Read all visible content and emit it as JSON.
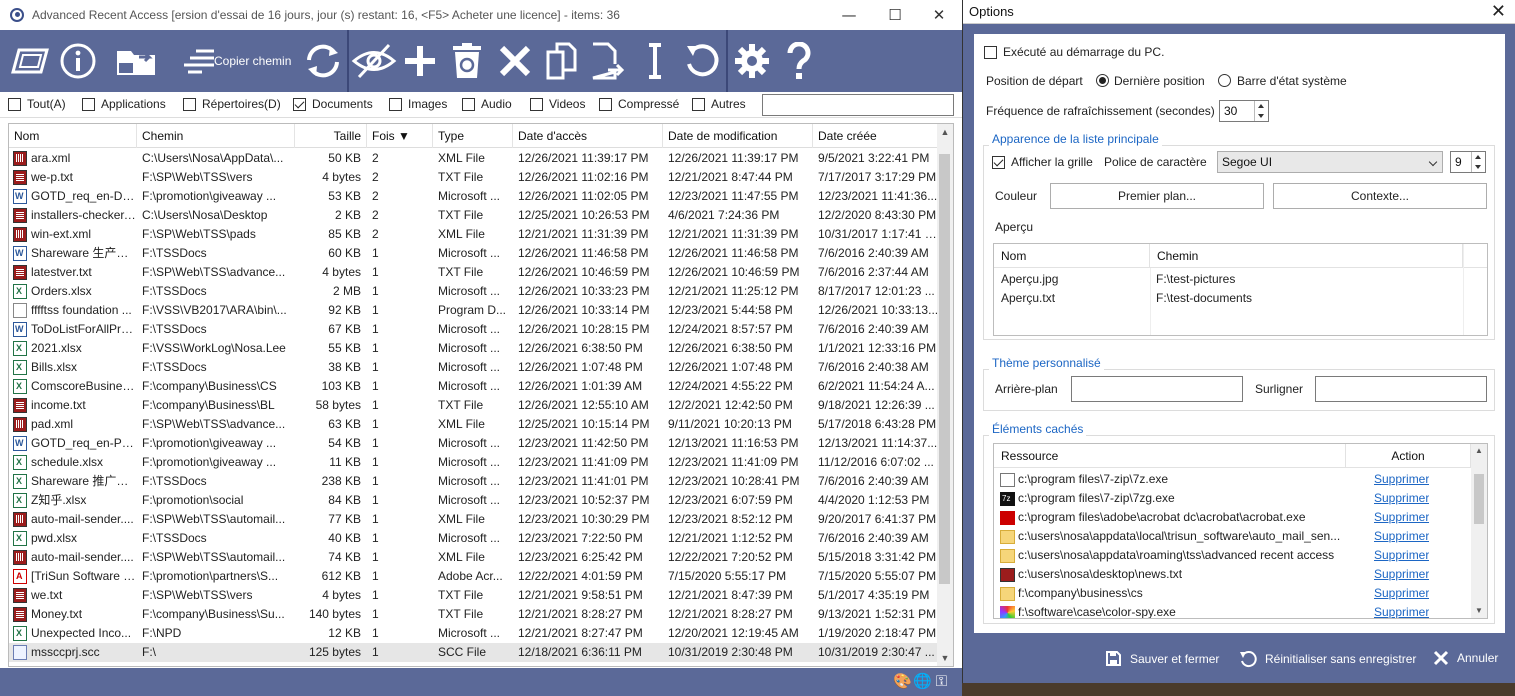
{
  "main_window": {
    "title": "Advanced Recent Access [ersion d'essai de 16 jours, jour (s) restant: 16, <F5> Acheter une licence] - items: 36",
    "minimize": "—",
    "maximize": "☐",
    "close": "✕"
  },
  "toolbar": {
    "copy_path_label": "Copier chemin"
  },
  "filters": [
    {
      "label": "Tout(A)",
      "checked": false
    },
    {
      "label": "Applications",
      "checked": false
    },
    {
      "label": "Répertoires(D)",
      "checked": false
    },
    {
      "label": "Documents",
      "checked": true
    },
    {
      "label": "Images",
      "checked": false
    },
    {
      "label": "Audio",
      "checked": false
    },
    {
      "label": "Videos",
      "checked": false
    },
    {
      "label": "Compressé",
      "checked": false
    },
    {
      "label": "Autres",
      "checked": false
    }
  ],
  "filter_search_value": "",
  "columns": [
    "Nom",
    "Chemin",
    "Taille",
    "Fois ▼",
    "Type",
    "Date d'accès",
    "Date de modification",
    "Date créée"
  ],
  "rows": [
    {
      "icon": "xml",
      "name": "ara.xml",
      "path": "C:\\Users\\Nosa\\AppData\\...",
      "size": "50 KB",
      "times": "2",
      "type": "XML File",
      "accessed": "12/26/2021 11:39:17 PM",
      "modified": "12/26/2021 11:39:17 PM",
      "created": "9/5/2021 3:22:41 PM"
    },
    {
      "icon": "text",
      "name": "we-p.txt",
      "path": "F:\\SP\\Web\\TSS\\vers",
      "size": "4 bytes",
      "times": "2",
      "type": "TXT File",
      "accessed": "12/26/2021 11:02:16 PM",
      "modified": "12/21/2021 8:47:44 PM",
      "created": "7/17/2017 3:17:29 PM"
    },
    {
      "icon": "word",
      "name": "GOTD_req_en-D2F...",
      "path": "F:\\promotion\\giveaway ...",
      "size": "53 KB",
      "times": "2",
      "type": "Microsoft ...",
      "accessed": "12/26/2021 11:02:05 PM",
      "modified": "12/23/2021 11:47:55 PM",
      "created": "12/23/2021 11:41:36..."
    },
    {
      "icon": "text",
      "name": "installers-checker....",
      "path": "C:\\Users\\Nosa\\Desktop",
      "size": "2 KB",
      "times": "2",
      "type": "TXT File",
      "accessed": "12/25/2021 10:26:53 PM",
      "modified": "4/6/2021 7:24:36 PM",
      "created": "12/2/2020 8:43:30 PM"
    },
    {
      "icon": "xml",
      "name": "win-ext.xml",
      "path": "F:\\SP\\Web\\TSS\\pads",
      "size": "85 KB",
      "times": "2",
      "type": "XML File",
      "accessed": "12/21/2021 11:31:39 PM",
      "modified": "12/21/2021 11:31:39 PM",
      "created": "10/31/2017 1:17:41 PM"
    },
    {
      "icon": "word",
      "name": "Shareware 生产经...",
      "path": "F:\\TSSDocs",
      "size": "60 KB",
      "times": "1",
      "type": "Microsoft ...",
      "accessed": "12/26/2021 11:46:58 PM",
      "modified": "12/26/2021 11:46:58 PM",
      "created": "7/6/2016 2:40:39 AM"
    },
    {
      "icon": "text",
      "name": "latestver.txt",
      "path": "F:\\SP\\Web\\TSS\\advance...",
      "size": "4 bytes",
      "times": "1",
      "type": "TXT File",
      "accessed": "12/26/2021 10:46:59 PM",
      "modified": "12/26/2021 10:46:59 PM",
      "created": "7/6/2016 2:37:44 AM"
    },
    {
      "icon": "excel",
      "name": "Orders.xlsx",
      "path": "F:\\TSSDocs",
      "size": "2 MB",
      "times": "1",
      "type": "Microsoft ...",
      "accessed": "12/26/2021 10:33:23 PM",
      "modified": "12/21/2021 11:25:12 PM",
      "created": "8/17/2017 12:01:23 ..."
    },
    {
      "icon": "blank",
      "name": "fffftss foundation ...",
      "path": "F:\\VSS\\VB2017\\ARA\\bin\\...",
      "size": "92 KB",
      "times": "1",
      "type": "Program D...",
      "accessed": "12/26/2021 10:33:14 PM",
      "modified": "12/23/2021 5:44:58 PM",
      "created": "12/26/2021 10:33:13..."
    },
    {
      "icon": "word",
      "name": "ToDoListForAllPro...",
      "path": "F:\\TSSDocs",
      "size": "67 KB",
      "times": "1",
      "type": "Microsoft ...",
      "accessed": "12/26/2021 10:28:15 PM",
      "modified": "12/24/2021 8:57:57 PM",
      "created": "7/6/2016 2:40:39 AM"
    },
    {
      "icon": "excel",
      "name": "2021.xlsx",
      "path": "F:\\VSS\\WorkLog\\Nosa.Lee",
      "size": "55 KB",
      "times": "1",
      "type": "Microsoft ...",
      "accessed": "12/26/2021 6:38:50 PM",
      "modified": "12/26/2021 6:38:50 PM",
      "created": "1/1/2021 12:33:16 PM"
    },
    {
      "icon": "excel",
      "name": "Bills.xlsx",
      "path": "F:\\TSSDocs",
      "size": "38 KB",
      "times": "1",
      "type": "Microsoft ...",
      "accessed": "12/26/2021 1:07:48 PM",
      "modified": "12/26/2021 1:07:48 PM",
      "created": "7/6/2016 2:40:38 AM"
    },
    {
      "icon": "excel",
      "name": "ComscoreBusines...",
      "path": "F:\\company\\Business\\CS",
      "size": "103 KB",
      "times": "1",
      "type": "Microsoft ...",
      "accessed": "12/26/2021 1:01:39 AM",
      "modified": "12/24/2021 4:55:22 PM",
      "created": "6/2/2021 11:54:24 A..."
    },
    {
      "icon": "text",
      "name": "income.txt",
      "path": "F:\\company\\Business\\BL",
      "size": "58 bytes",
      "times": "1",
      "type": "TXT File",
      "accessed": "12/26/2021 12:55:10 AM",
      "modified": "12/2/2021 12:42:50 PM",
      "created": "9/18/2021 12:26:39 ..."
    },
    {
      "icon": "xml",
      "name": "pad.xml",
      "path": "F:\\SP\\Web\\TSS\\advance...",
      "size": "63 KB",
      "times": "1",
      "type": "XML File",
      "accessed": "12/25/2021 10:15:14 PM",
      "modified": "9/11/2021 10:20:13 PM",
      "created": "5/17/2018 6:43:28 PM"
    },
    {
      "icon": "word",
      "name": "GOTD_req_en-PTX...",
      "path": "F:\\promotion\\giveaway ...",
      "size": "54 KB",
      "times": "1",
      "type": "Microsoft ...",
      "accessed": "12/23/2021 11:42:50 PM",
      "modified": "12/13/2021 11:16:53 PM",
      "created": "12/13/2021 11:14:37..."
    },
    {
      "icon": "excel",
      "name": "schedule.xlsx",
      "path": "F:\\promotion\\giveaway ...",
      "size": "11 KB",
      "times": "1",
      "type": "Microsoft ...",
      "accessed": "12/23/2021 11:41:09 PM",
      "modified": "12/23/2021 11:41:09 PM",
      "created": "11/12/2016 6:07:02 ..."
    },
    {
      "icon": "excel",
      "name": "Shareware 推广经...",
      "path": "F:\\TSSDocs",
      "size": "238 KB",
      "times": "1",
      "type": "Microsoft ...",
      "accessed": "12/23/2021 11:41:01 PM",
      "modified": "12/23/2021 10:28:41 PM",
      "created": "7/6/2016 2:40:39 AM"
    },
    {
      "icon": "excel",
      "name": "Z知乎.xlsx",
      "path": "F:\\promotion\\social",
      "size": "84 KB",
      "times": "1",
      "type": "Microsoft ...",
      "accessed": "12/23/2021 10:52:37 PM",
      "modified": "12/23/2021 6:07:59 PM",
      "created": "4/4/2020 1:12:53 PM"
    },
    {
      "icon": "xml",
      "name": "auto-mail-sender....",
      "path": "F:\\SP\\Web\\TSS\\automail...",
      "size": "77 KB",
      "times": "1",
      "type": "XML File",
      "accessed": "12/23/2021 10:30:29 PM",
      "modified": "12/23/2021 8:52:12 PM",
      "created": "9/20/2017 6:41:37 PM"
    },
    {
      "icon": "excel",
      "name": "pwd.xlsx",
      "path": "F:\\TSSDocs",
      "size": "40 KB",
      "times": "1",
      "type": "Microsoft ...",
      "accessed": "12/23/2021 7:22:50 PM",
      "modified": "12/21/2021 1:12:52 PM",
      "created": "7/6/2016 2:40:39 AM"
    },
    {
      "icon": "xml",
      "name": "auto-mail-sender....",
      "path": "F:\\SP\\Web\\TSS\\automail...",
      "size": "74 KB",
      "times": "1",
      "type": "XML File",
      "accessed": "12/23/2021 6:25:42 PM",
      "modified": "12/22/2021 7:20:52 PM",
      "created": "5/15/2018 3:31:42 PM"
    },
    {
      "icon": "pdf",
      "name": "[TriSun Software x...",
      "path": "F:\\promotion\\partners\\S...",
      "size": "612 KB",
      "times": "1",
      "type": "Adobe Acr...",
      "accessed": "12/22/2021 4:01:59 PM",
      "modified": "7/15/2020 5:55:17 PM",
      "created": "7/15/2020 5:55:07 PM"
    },
    {
      "icon": "text",
      "name": "we.txt",
      "path": "F:\\SP\\Web\\TSS\\vers",
      "size": "4 bytes",
      "times": "1",
      "type": "TXT File",
      "accessed": "12/21/2021 9:58:51 PM",
      "modified": "12/21/2021 8:47:39 PM",
      "created": "5/1/2017 4:35:19 PM"
    },
    {
      "icon": "text",
      "name": "Money.txt",
      "path": "F:\\company\\Business\\Su...",
      "size": "140 bytes",
      "times": "1",
      "type": "TXT File",
      "accessed": "12/21/2021 8:28:27 PM",
      "modified": "12/21/2021 8:28:27 PM",
      "created": "9/13/2021 1:52:31 PM"
    },
    {
      "icon": "excel",
      "name": "Unexpected Inco...",
      "path": "F:\\NPD",
      "size": "12 KB",
      "times": "1",
      "type": "Microsoft ...",
      "accessed": "12/21/2021 8:27:47 PM",
      "modified": "12/20/2021 12:19:45 AM",
      "created": "1/19/2020 2:18:47 PM"
    },
    {
      "icon": "scc",
      "name": "mssccprj.scc",
      "path": "F:\\",
      "size": "125 bytes",
      "times": "1",
      "type": "SCC File",
      "accessed": "12/18/2021 6:36:11 PM",
      "modified": "10/31/2019 2:30:48 PM",
      "created": "10/31/2019 2:30:47 ...",
      "selected": true
    }
  ],
  "options": {
    "title": "Options",
    "close": "✕",
    "startup_label": "Exécuté au démarrage du PC.",
    "startup_checked": false,
    "start_position_label": "Position de départ",
    "start_pos_opt1": "Dernière position",
    "start_pos_opt2": "Barre d'état système",
    "start_pos_selected": "Dernière position",
    "refresh_label": "Fréquence de rafraîchissement (secondes)",
    "refresh_value": "30",
    "appearance_group": "Apparence de la liste principale",
    "show_grid_label": "Afficher la grille",
    "show_grid_checked": true,
    "font_label": "Police de caractère",
    "font_value": "Segoe UI",
    "font_size": "9",
    "color_label": "Couleur",
    "foreground_button": "Premier plan...",
    "background_button": "Contexte...",
    "preview_label": "Aperçu",
    "preview_columns": [
      "Nom",
      "Chemin"
    ],
    "preview_rows": [
      {
        "name": "Aperçu.jpg",
        "path": "F:\\test-pictures"
      },
      {
        "name": "Aperçu.txt",
        "path": "F:\\test-documents"
      }
    ],
    "theme_group": "Thème personnalisé",
    "theme_bg_label": "Arrière-plan",
    "theme_bg_value": "",
    "theme_hl_label": "Surligner",
    "theme_hl_value": "",
    "hidden_group": "Éléments cachés",
    "hidden_columns": [
      "Ressource",
      "Action"
    ],
    "hidden_items": [
      {
        "icon": "exe",
        "path": "c:\\program files\\7-zip\\7z.exe",
        "action": "Supprimer"
      },
      {
        "icon": "sevz",
        "path": "c:\\program files\\7-zip\\7zg.exe",
        "action": "Supprimer"
      },
      {
        "icon": "acro",
        "path": "c:\\program files\\adobe\\acrobat dc\\acrobat\\acrobat.exe",
        "action": "Supprimer"
      },
      {
        "icon": "folder",
        "path": "c:\\users\\nosa\\appdata\\local\\trisun_software\\auto_mail_sen...",
        "action": "Supprimer"
      },
      {
        "icon": "folder",
        "path": "c:\\users\\nosa\\appdata\\roaming\\tss\\advanced recent access",
        "action": "Supprimer"
      },
      {
        "icon": "news",
        "path": "c:\\users\\nosa\\desktop\\news.txt",
        "action": "Supprimer"
      },
      {
        "icon": "folder",
        "path": "f:\\company\\business\\cs",
        "action": "Supprimer"
      },
      {
        "icon": "spy",
        "path": "f:\\software\\case\\color-spy.exe",
        "action": "Supprimer"
      }
    ],
    "save_button": "Sauver et fermer",
    "reset_button": "Réinitialiser sans enregistrer",
    "cancel_button": "Annuler"
  },
  "colors": {
    "toolbar_bg": "#5b6998",
    "link": "#1c66c4",
    "group_title": "#1c66c4"
  }
}
